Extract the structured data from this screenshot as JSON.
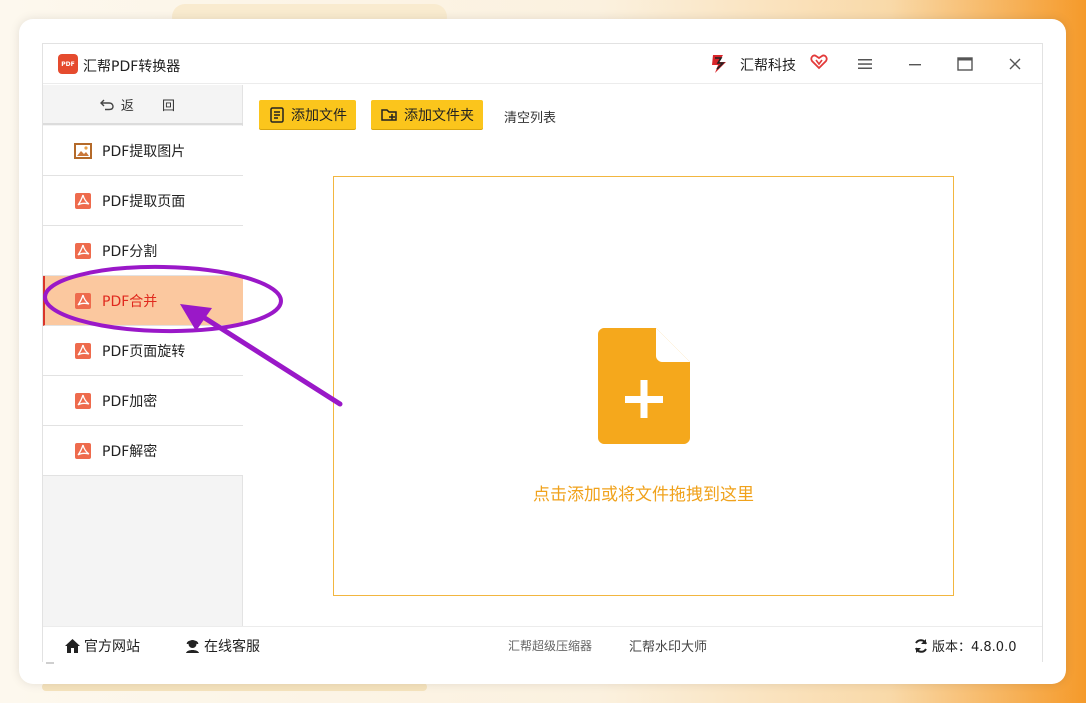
{
  "app": {
    "title": "汇帮PDF转换器",
    "logo_text": "PDF",
    "brand": "汇帮科技"
  },
  "sidebar": {
    "back_label": "返 回",
    "items": [
      {
        "label": "PDF提取图片",
        "icon": "image-icon"
      },
      {
        "label": "PDF提取页面",
        "icon": "pdf-icon"
      },
      {
        "label": "PDF分割",
        "icon": "pdf-icon"
      },
      {
        "label": "PDF合并",
        "icon": "pdf-icon",
        "active": true
      },
      {
        "label": "PDF页面旋转",
        "icon": "pdf-icon"
      },
      {
        "label": "PDF加密",
        "icon": "pdf-icon"
      },
      {
        "label": "PDF解密",
        "icon": "pdf-icon"
      }
    ]
  },
  "toolbar": {
    "add_file": "添加文件",
    "add_folder": "添加文件夹",
    "clear_list": "清空列表"
  },
  "dropzone": {
    "text": "点击添加或将文件拖拽到这里"
  },
  "footer": {
    "website": "官方网站",
    "support": "在线客服",
    "compressor": "汇帮超级压缩器",
    "watermark": "汇帮水印大师",
    "version": "版本：4.8.0.0"
  },
  "colors": {
    "accent": "#fbc51c",
    "active_bg": "#fbc89f",
    "active_text": "#e02a1e",
    "annotation": "#9a18c8",
    "drop_text": "#f0a21c"
  }
}
